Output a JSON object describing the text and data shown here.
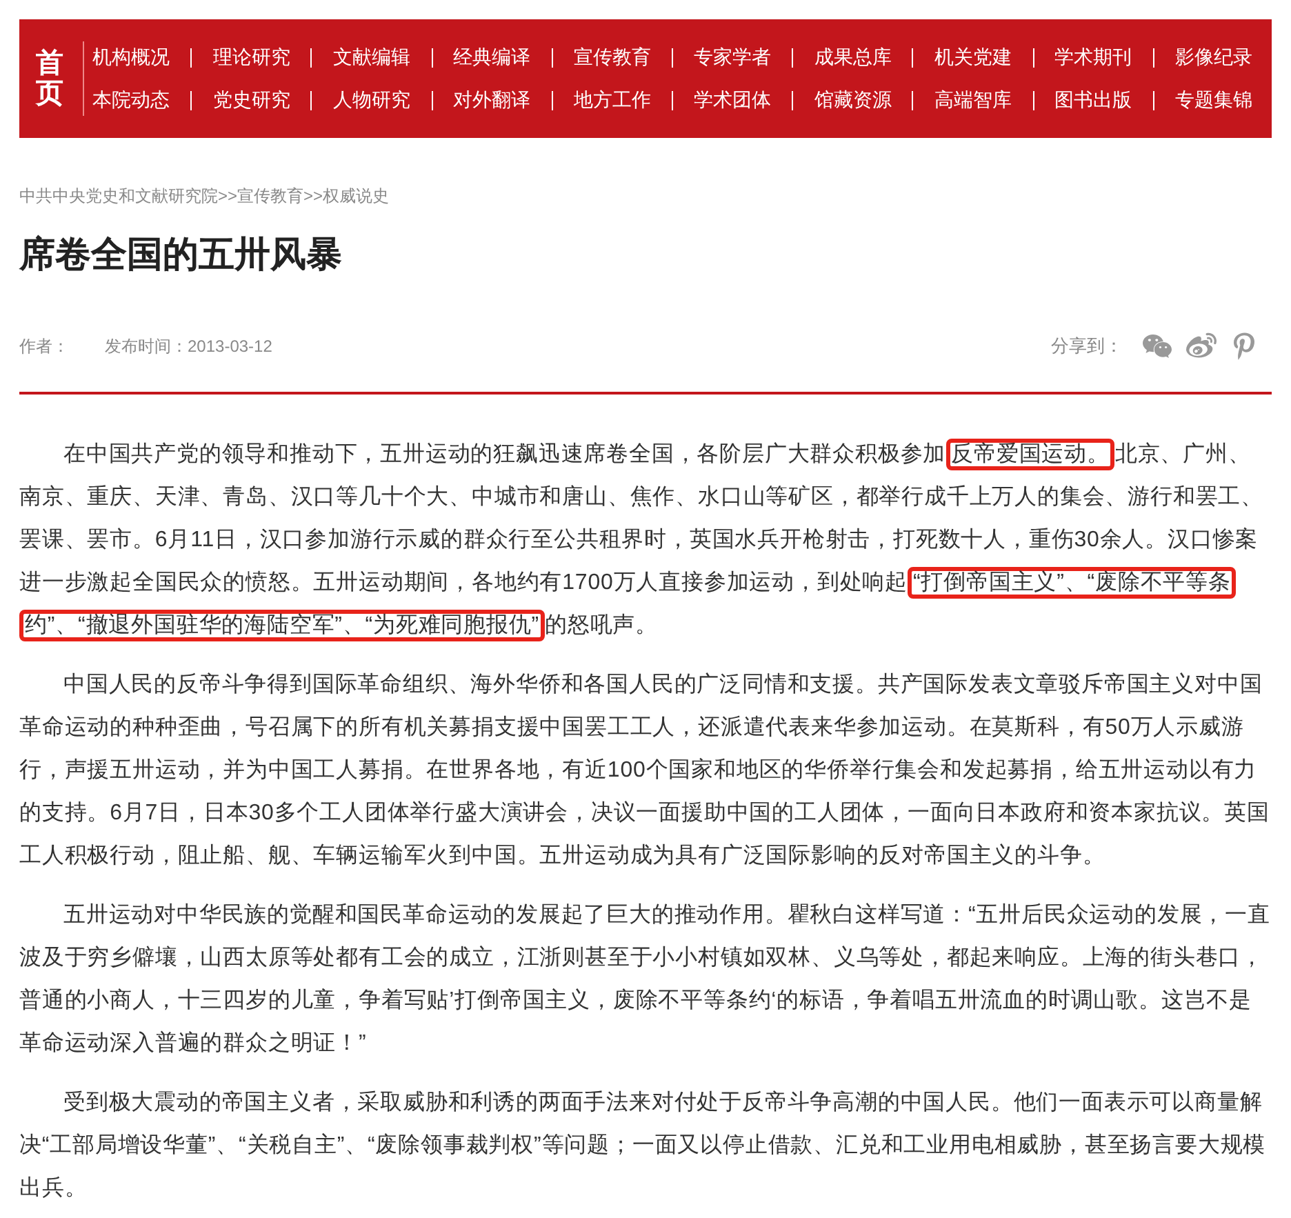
{
  "nav": {
    "home": "首页",
    "rows": [
      [
        "机构概况",
        "理论研究",
        "文献编辑",
        "经典编译",
        "宣传教育",
        "专家学者",
        "成果总库",
        "机关党建",
        "学术期刊",
        "影像纪录"
      ],
      [
        "本院动态",
        "党史研究",
        "人物研究",
        "对外翻译",
        "地方工作",
        "学术团体",
        "馆藏资源",
        "高端智库",
        "图书出版",
        "专题集锦"
      ]
    ]
  },
  "breadcrumb": "中共中央党史和文献研究院>>宣传教育>>权威说史",
  "title": "席卷全国的五卅风暴",
  "meta": {
    "author_label": "作者：",
    "date": "发布时间：2013-03-12",
    "share_label": "分享到："
  },
  "paragraphs": [
    {
      "segments": [
        {
          "text": "在中国共产党的领导和推动下，五卅运动的狂飙迅速席卷全国，各阶层广大群众积极参加",
          "boxed": false
        },
        {
          "text": "反帝爱国运动。",
          "boxed": true
        },
        {
          "text": "北京、广州、南京、重庆、天津、青岛、汉口等几十个大、中城市和唐山、焦作、水口山等矿区，都举行成千上万人的集会、游行和罢工、罢课、罢市。6月11日，汉口参加游行示威的群众行至公共租界时，英国水兵开枪射击，打死数十人，重伤30余人。汉口惨案进一步激起全国民众的愤怒。五卅运动期间，各地约有1700万人直接参加运动，到处响起",
          "boxed": false
        },
        {
          "text": "“打倒帝国主义”、“废除不平等条约”、“撤退外国驻华的海陆空军”、“为死难同胞报仇”",
          "boxed": true
        },
        {
          "text": "的怒吼声。",
          "boxed": false
        }
      ]
    },
    {
      "segments": [
        {
          "text": "中国人民的反帝斗争得到国际革命组织、海外华侨和各国人民的广泛同情和支援。共产国际发表文章驳斥帝国主义对中国革命运动的种种歪曲，号召属下的所有机关募捐支援中国罢工工人，还派遣代表来华参加运动。在莫斯科，有50万人示威游行，声援五卅运动，并为中国工人募捐。在世界各地，有近100个国家和地区的华侨举行集会和发起募捐，给五卅运动以有力的支持。6月7日，日本30多个工人团体举行盛大演讲会，决议一面援助中国的工人团体，一面向日本政府和资本家抗议。英国工人积极行动，阻止船、舰、车辆运输军火到中国。五卅运动成为具有广泛国际影响的反对帝国主义的斗争。",
          "boxed": false
        }
      ]
    },
    {
      "segments": [
        {
          "text": "五卅运动对中华民族的觉醒和国民革命运动的发展起了巨大的推动作用。瞿秋白这样写道：“五卅后民众运动的发展，一直波及于穷乡僻壤，山西太原等处都有工会的成立，江浙则甚至于小小村镇如双林、义乌等处，都起来响应。上海的街头巷口，普通的小商人，十三四岁的儿童，争着写贴’打倒帝国主义，废除不平等条约‘的标语，争着唱五卅流血的时调山歌。这岂不是革命运动深入普遍的群众之明证！”",
          "boxed": false
        }
      ]
    },
    {
      "segments": [
        {
          "text": "受到极大震动的帝国主义者，采取威胁和利诱的两面手法来对付处于反帝斗争高潮的中国人民。他们一面表示可以商量解决“工部局增设华董”、“关税自主”、“废除领事裁判权”等问题；一面又以停止借款、汇兑和工业用电相威胁，甚至扬言要大规模出兵。",
          "boxed": false
        }
      ]
    }
  ]
}
